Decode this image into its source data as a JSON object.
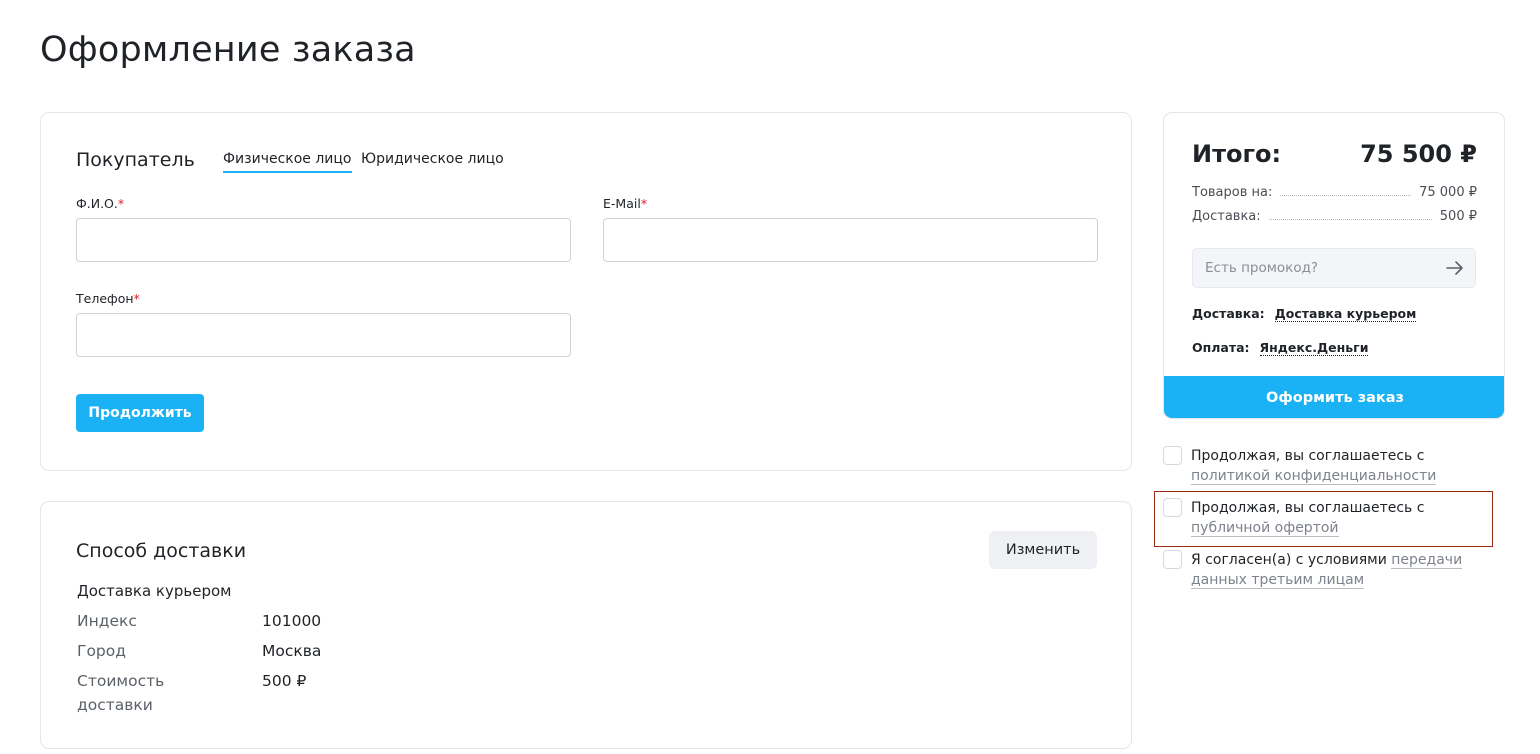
{
  "page": {
    "title": "Оформление заказа"
  },
  "buyer": {
    "title": "Покупатель",
    "tabs": [
      {
        "label": "Физическое лицо",
        "active": true
      },
      {
        "label": "Юридическое лицо",
        "active": false
      }
    ],
    "fields": {
      "fio": {
        "label": "Ф.И.О.",
        "required_mark": "*",
        "value": ""
      },
      "email": {
        "label": "E-Mail",
        "required_mark": "*",
        "value": ""
      },
      "phone": {
        "label": "Телефон",
        "required_mark": "*",
        "value": ""
      }
    },
    "continue_label": "Продолжить"
  },
  "delivery": {
    "title": "Способ доставки",
    "change_label": "Изменить",
    "method_name": "Доставка курьером",
    "rows": [
      {
        "label": "Индекс",
        "value": "101000"
      },
      {
        "label": "Город",
        "value": "Москва"
      },
      {
        "label": "Стоимость доставки",
        "value": "500 ₽"
      }
    ]
  },
  "summary": {
    "total_label": "Итого:",
    "total_value": "75 500 ₽",
    "items_label": "Товаров на:",
    "items_value": "75 000 ₽",
    "shipping_label": "Доставка:",
    "shipping_value": "500 ₽",
    "promo_placeholder": "Есть промокод?",
    "delivery_option_label": "Доставка:",
    "delivery_option_value": "Доставка курьером",
    "payment_option_label": "Оплата:",
    "payment_option_value": "Яндекс.Деньги",
    "order_button_label": "Оформить заказ"
  },
  "agreements": [
    {
      "text": "Продолжая, вы соглашаетесь с ",
      "link": "политикой конфиденциальности",
      "checked": false
    },
    {
      "text": "Продолжая, вы соглашаетесь с ",
      "link": "публичной офертой",
      "checked": false,
      "highlighted": true
    },
    {
      "text": "Я согласен(а) с условиями ",
      "link": "передачи данных третьим лицам",
      "checked": false
    }
  ],
  "colors": {
    "accent": "#1ab2f4",
    "required": "#e0202a",
    "highlight_border": "#9a2a10"
  },
  "icons": {
    "promo_submit": "arrow-right-icon"
  }
}
